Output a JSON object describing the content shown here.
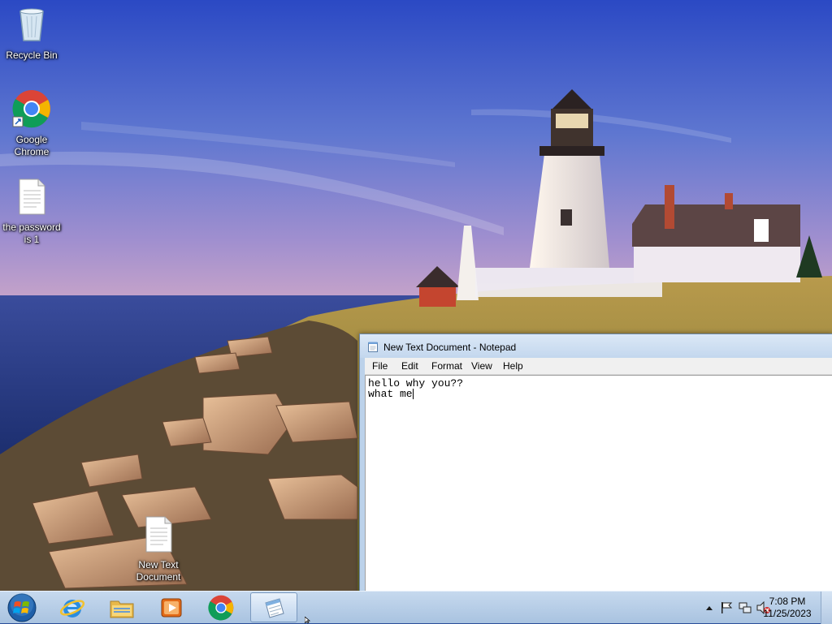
{
  "desktop": {
    "icons": [
      {
        "label": "Recycle Bin",
        "icon": "recycle-bin-icon"
      },
      {
        "label": "Google Chrome",
        "icon": "chrome-icon"
      },
      {
        "label": "the password is 1",
        "icon": "text-file-icon"
      },
      {
        "label": "New Text Document",
        "icon": "text-file-icon"
      }
    ]
  },
  "notepad": {
    "title": "New Text Document - Notepad",
    "menu": [
      "File",
      "Edit",
      "Format",
      "View",
      "Help"
    ],
    "content": [
      "hello why you??",
      "what me"
    ]
  },
  "taskbar": {
    "pinned": [
      {
        "icon": "start-orb-icon"
      },
      {
        "icon": "internet-explorer-icon"
      },
      {
        "icon": "file-explorer-icon"
      },
      {
        "icon": "media-player-icon"
      },
      {
        "icon": "chrome-icon"
      },
      {
        "icon": "notepad-icon",
        "active": true
      }
    ],
    "tray_icons": [
      "show-hidden-icons-icon",
      "action-center-flag-icon",
      "network-icon",
      "volume-muted-icon"
    ],
    "clock": {
      "time": "7:08 PM",
      "date": "11/25/2023"
    }
  },
  "colors": {
    "sky_top": "#2f4fbf",
    "sky_horizon": "#b39bd0",
    "sea": "#2a3f8a",
    "taskbar": "#b8cfe8",
    "window_frame": "#bcd2ea"
  }
}
